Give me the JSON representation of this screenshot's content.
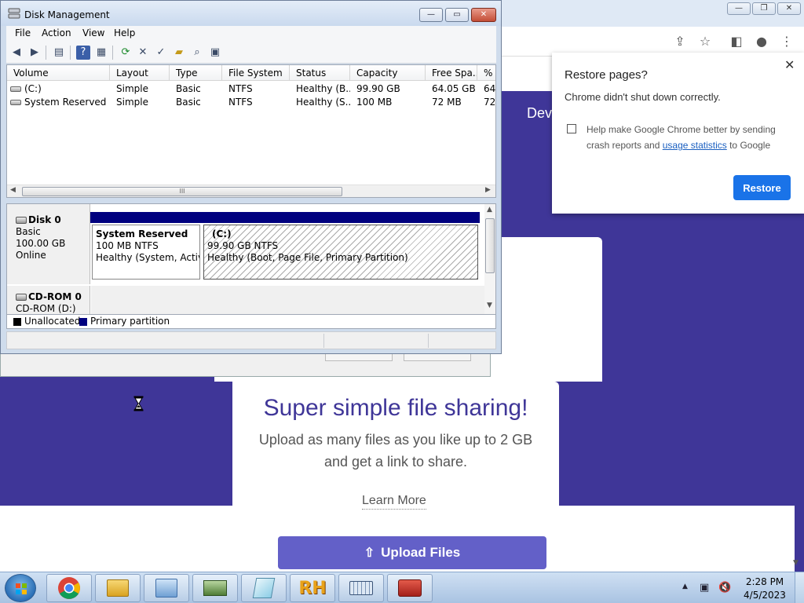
{
  "disk_management": {
    "title": "Disk Management",
    "menu": [
      "File",
      "Action",
      "View",
      "Help"
    ],
    "window_buttons": {
      "minimize": "—",
      "maximize": "▭",
      "close": "✕"
    },
    "columns": [
      "Volume",
      "Layout",
      "Type",
      "File System",
      "Status",
      "Capacity",
      "Free Spa...",
      "% F"
    ],
    "volumes": [
      {
        "volume": "(C:)",
        "layout": "Simple",
        "type": "Basic",
        "fs": "NTFS",
        "status": "Healthy (B...",
        "capacity": "99.90 GB",
        "free": "64.05 GB",
        "pct": "64"
      },
      {
        "volume": "System Reserved",
        "layout": "Simple",
        "type": "Basic",
        "fs": "NTFS",
        "status": "Healthy (S...",
        "capacity": "100 MB",
        "free": "72 MB",
        "pct": "72"
      }
    ],
    "disks": [
      {
        "name": "Disk 0",
        "kind": "Basic",
        "size": "100.00 GB",
        "state": "Online"
      },
      {
        "name": "CD-ROM 0",
        "kind": "CD-ROM (D:)"
      }
    ],
    "partitions": [
      {
        "name": "System Reserved",
        "size": "100 MB NTFS",
        "status": "Healthy (System, Active, Primary Partition)"
      },
      {
        "name": "(C:)",
        "size": "99.90 GB NTFS",
        "status": "Healthy (Boot, Page File, Primary Partition)"
      }
    ],
    "legend": [
      {
        "label": "Unallocated",
        "color": "#000000"
      },
      {
        "label": "Primary partition",
        "color": "#00007f"
      }
    ]
  },
  "chrome": {
    "restore_popup": {
      "title": "Restore pages?",
      "message": "Chrome didn't shut down correctly.",
      "help_text_before": "Help make Google Chrome better by sending crash reports and ",
      "help_link": "usage statistics",
      "help_text_after": " to Google",
      "button": "Restore",
      "close": "✕"
    },
    "page": {
      "nav_text": "Dev",
      "hero_title": "Super simple file sharing!",
      "hero_subtitle": "Upload as many files as you like up to 2 GB and get a link to share.",
      "learn_more": "Learn More",
      "upload_button": "Upload Files"
    },
    "colors": {
      "brand_purple": "#3f3698",
      "button_purple": "#6360c8",
      "restore_blue": "#1a73e8"
    }
  },
  "taskbar": {
    "time": "2:28 PM",
    "date": "4/5/2023",
    "pinned": [
      "chrome-icon",
      "explorer-icon",
      "control-panel-icon",
      "device-manager-icon",
      "notepad-icon",
      "rh-icon",
      "keyboard-icon",
      "toolbox-icon"
    ],
    "rh_label": "RH"
  }
}
